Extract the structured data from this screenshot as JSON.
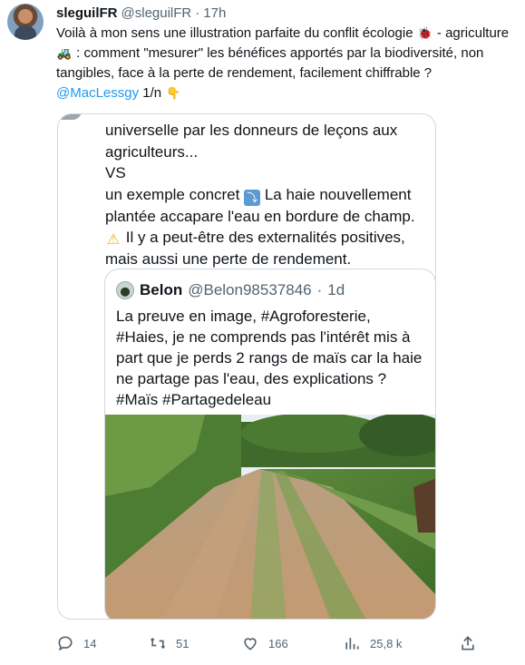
{
  "tweet": {
    "author_name": "sleguilFR",
    "author_handle": "@sleguilFR",
    "separator": "·",
    "time": "17h",
    "text_1": "Voilà à mon sens une illustration parfaite du conflit écologie",
    "emoji_1": "🐞",
    "text_2": "- agriculture",
    "emoji_2": "🚜",
    "text_3": ": comment \"mesurer\" les bénéfices apportés par la biodiversité, non tangibles, face à la perte de rendement, facilement chiffrable ?",
    "mention": "@MacLessgy",
    "thread_count": "1/n",
    "emoji_3": "👇"
  },
  "media": {
    "line_1": "universelle par les donneurs de leçons aux agriculteurs...",
    "vs": "VS",
    "line_2": "un exemple concret",
    "line_2_icon": "⤵",
    "line_3": "La haie nouvellement plantée accapare l'eau en bordure de champ.",
    "warn_icon": "⚠",
    "line_4": "Il y a peut-être des externalités positives, mais aussi une perte de rendement."
  },
  "quote": {
    "name": "Belon",
    "handle": "@Belon98537846",
    "separator": "·",
    "time": "1d",
    "text": "La preuve en image, #Agroforesterie, #Haies, je ne comprends pas l'intérêt mis à part que je perds 2 rangs de maïs car la haie ne partage pas l'eau, des explications ? #Maïs #Partagedeleau"
  },
  "actions": {
    "replies": "14",
    "retweets": "51",
    "likes": "166",
    "views": "25,8 k",
    "icons": [
      "reply-icon",
      "retweet-icon",
      "like-icon",
      "views-icon",
      "share-icon"
    ]
  },
  "colors": {
    "link": "#1d9bf0",
    "muted": "#536471",
    "text": "#0f1419",
    "border": "#cfd9de"
  }
}
